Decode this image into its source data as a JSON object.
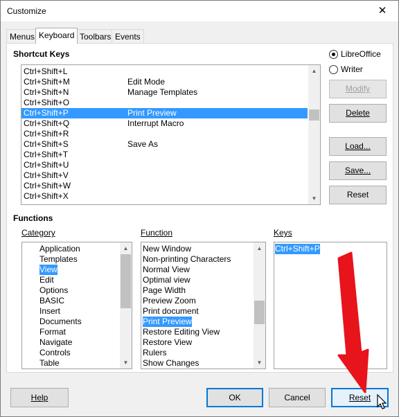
{
  "window": {
    "title": "Customize",
    "close_glyph": "✕"
  },
  "tabs": [
    {
      "label": "Menus",
      "active": false
    },
    {
      "label": "Keyboard",
      "active": true
    },
    {
      "label": "Toolbars",
      "active": false
    },
    {
      "label": "Events",
      "active": false
    }
  ],
  "shortcuts": {
    "title": "Shortcut Keys",
    "rows": [
      {
        "key": "Ctrl+Shift+L",
        "command": ""
      },
      {
        "key": "Ctrl+Shift+M",
        "command": "Edit Mode"
      },
      {
        "key": "Ctrl+Shift+N",
        "command": "Manage Templates"
      },
      {
        "key": "Ctrl+Shift+O",
        "command": ""
      },
      {
        "key": "Ctrl+Shift+P",
        "command": "Print Preview",
        "selected": true
      },
      {
        "key": "Ctrl+Shift+Q",
        "command": "Interrupt Macro"
      },
      {
        "key": "Ctrl+Shift+R",
        "command": ""
      },
      {
        "key": "Ctrl+Shift+S",
        "command": "Save As"
      },
      {
        "key": "Ctrl+Shift+T",
        "command": ""
      },
      {
        "key": "Ctrl+Shift+U",
        "command": ""
      },
      {
        "key": "Ctrl+Shift+V",
        "command": ""
      },
      {
        "key": "Ctrl+Shift+W",
        "command": ""
      },
      {
        "key": "Ctrl+Shift+X",
        "command": ""
      }
    ]
  },
  "scope": {
    "options": [
      {
        "label": "LibreOffice",
        "checked": true
      },
      {
        "label": "Writer",
        "checked": false
      }
    ]
  },
  "side_buttons": {
    "modify": "Modify",
    "delete": "Delete",
    "load": "Load...",
    "save": "Save...",
    "reset": "Reset"
  },
  "functions": {
    "title": "Functions",
    "category_label": "Category",
    "function_label": "Function",
    "keys_label": "Keys",
    "categories": [
      {
        "label": "Application"
      },
      {
        "label": "Templates"
      },
      {
        "label": "View",
        "selected": true
      },
      {
        "label": "Edit"
      },
      {
        "label": "Options"
      },
      {
        "label": "BASIC"
      },
      {
        "label": "Insert"
      },
      {
        "label": "Documents"
      },
      {
        "label": "Format"
      },
      {
        "label": "Navigate"
      },
      {
        "label": "Controls"
      },
      {
        "label": "Table"
      }
    ],
    "function_items": [
      {
        "label": "New Window"
      },
      {
        "label": "Non-printing Characters"
      },
      {
        "label": "Normal View"
      },
      {
        "label": "Optimal view"
      },
      {
        "label": "Page Width"
      },
      {
        "label": "Preview Zoom"
      },
      {
        "label": "Print document"
      },
      {
        "label": "Print Preview",
        "selected": true
      },
      {
        "label": "Restore Editing View"
      },
      {
        "label": "Restore View"
      },
      {
        "label": "Rulers"
      },
      {
        "label": "Show Changes"
      }
    ],
    "keys": [
      {
        "label": "Ctrl+Shift+P",
        "selected": true
      }
    ]
  },
  "footer": {
    "help": "Help",
    "ok": "OK",
    "cancel": "Cancel",
    "reset": "Reset"
  },
  "colors": {
    "selection": "#3399ff",
    "focus_border": "#0078d7",
    "arrow": "#e8141b"
  }
}
